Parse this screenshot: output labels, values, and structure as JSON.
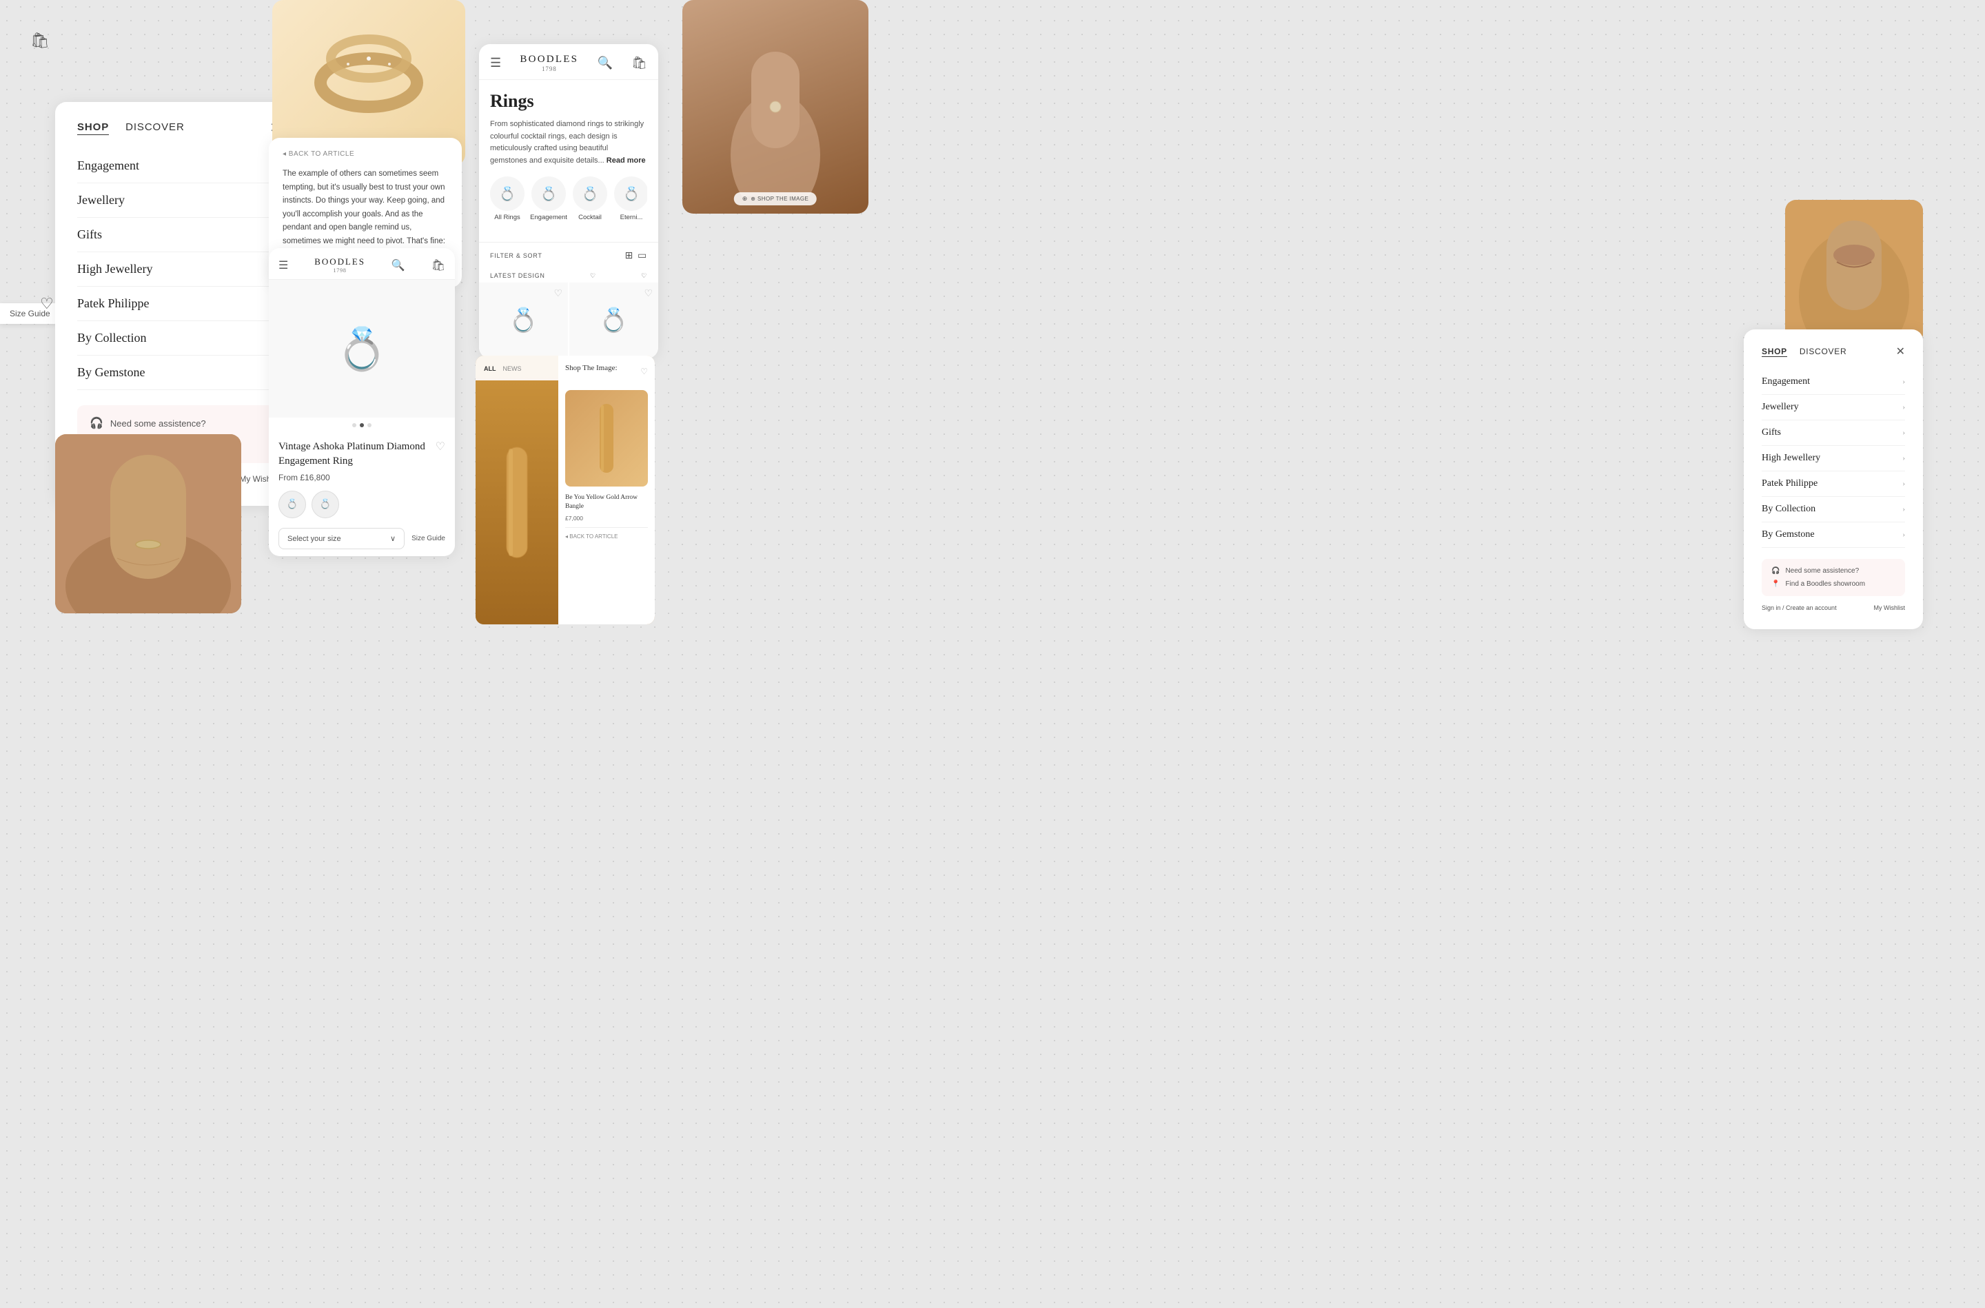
{
  "brand": {
    "name": "BOODLES",
    "year": "1798"
  },
  "nav_large": {
    "tab_shop": "SHOP",
    "tab_discover": "DISCOVER",
    "items": [
      {
        "label": "Engagement"
      },
      {
        "label": "Jewellery"
      },
      {
        "label": "Gifts"
      },
      {
        "label": "High Jewellery"
      },
      {
        "label": "Patek Philippe"
      },
      {
        "label": "By Collection"
      },
      {
        "label": "By Gemstone"
      }
    ],
    "footer_assist": "Need some assistence?",
    "footer_showroom": "Find a Boodles showroom",
    "sign_in": "Sign in / Create an account",
    "my_wishlist": "My Wishlist"
  },
  "nav_right": {
    "tab_shop": "SHOP",
    "tab_discover": "DISCOVER",
    "items": [
      {
        "label": "Engagement"
      },
      {
        "label": "Jewellery"
      },
      {
        "label": "Gifts"
      },
      {
        "label": "High Jewellery"
      },
      {
        "label": "Patek Philippe"
      },
      {
        "label": "By Collection"
      },
      {
        "label": "By Gemstone"
      }
    ],
    "footer_assist": "Need some assistence?",
    "footer_showroom": "Find a Boodles showroom",
    "sign_in": "Sign in / Create an account",
    "my_wishlist": "My Wishlist"
  },
  "rings_page": {
    "title": "Rings",
    "description": "From sophisticated diamond rings to strikingly colourful cocktail rings, each design is meticulously crafted using beautiful gemstones and exquisite details...",
    "read_more": "Read more",
    "filter_label": "FILTER & SORT",
    "latest_design": "LATEST DESIGN",
    "categories": [
      {
        "label": "All Rings"
      },
      {
        "label": "Engagement"
      },
      {
        "label": "Cocktail"
      },
      {
        "label": "Eterni..."
      }
    ]
  },
  "product": {
    "title": "Vintage Ashoka Platinum Diamond Engagement Ring",
    "price": "From £16,800",
    "size_placeholder": "Select your size",
    "size_guide": "Size Guide"
  },
  "article": {
    "back_label": "◂ BACK TO ARTICLE",
    "text": "The example of others can sometimes seem tempting, but it's usually best to trust your own instincts. Do things your way. Keep going, and you'll accomplish your goals. And as the pendant and open bangle remind us, sometimes we might need to pivot. That's fine: there's nothing wrong with a determined volte-face. In fact, it might be the whole point."
  },
  "shop_image": {
    "title": "Shop The Image:",
    "product_name": "Be You Yellow Gold Arrow Bangle",
    "product_price": "£7,000",
    "back_label": "◂ BACK TO ARTICLE",
    "tabs": [
      "ALL",
      "NEWS"
    ],
    "close_label": "✕"
  },
  "size_guide_pill": "Size Guide",
  "photo_bangle": {
    "shop_label": "⊕ SHOP THE IMAGE"
  },
  "photo_hand_right": {
    "shop_label": "⊕ SHOP THE IMAGE"
  }
}
